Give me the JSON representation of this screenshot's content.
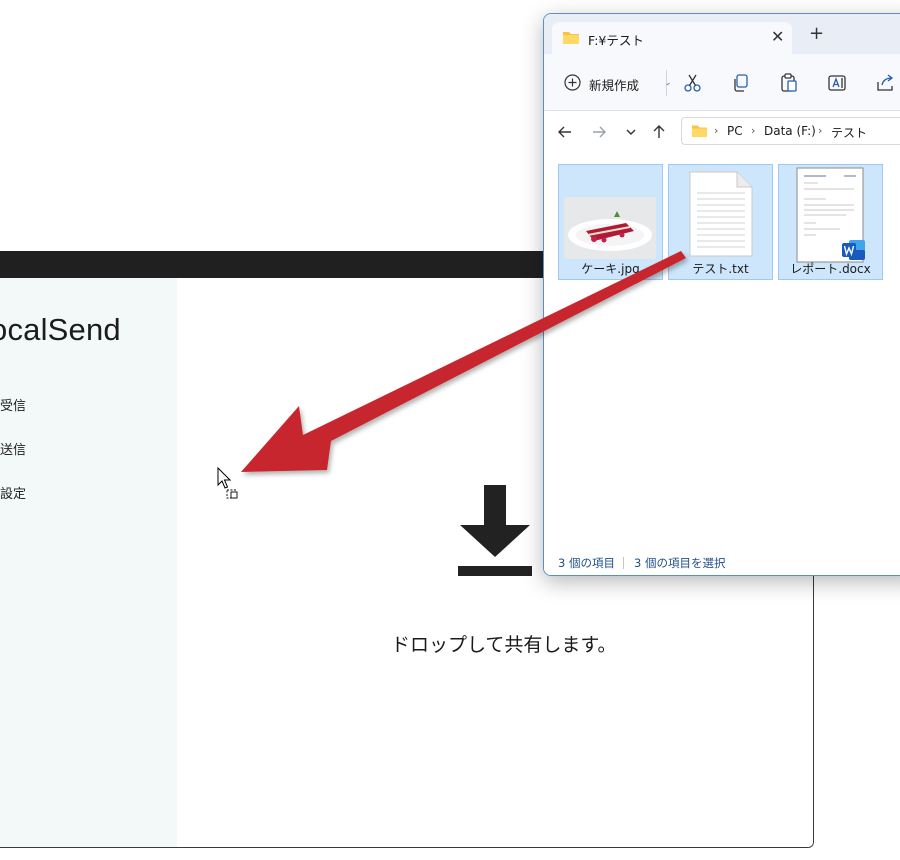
{
  "localsend": {
    "app_name": "ocalSend",
    "nav": [
      {
        "label": "受信"
      },
      {
        "label": "送信"
      },
      {
        "label": "設定"
      }
    ],
    "drop_text": "ドロップして共有します。"
  },
  "explorer": {
    "tab_title": "F:¥テスト",
    "tab_close": "✕",
    "new_tab": "+",
    "toolbar": {
      "new_label": "新規作成",
      "new_chevron": "⌄"
    },
    "icons": {
      "new": "plus-circle-icon",
      "cut": "scissors-icon",
      "copy": "copy-icon",
      "paste": "clipboard-icon",
      "rename": "rename-icon",
      "share": "share-icon",
      "back": "arrow-left-icon",
      "forward": "arrow-right-icon",
      "recent": "chevron-down-icon",
      "up": "arrow-up-icon",
      "folder": "folder-icon",
      "word": "word-icon"
    },
    "breadcrumb": [
      "PC",
      "Data (F:)",
      "テスト"
    ],
    "breadcrumb_sep": "›",
    "files": [
      {
        "name": "ケーキ.jpg"
      },
      {
        "name": "テスト.txt"
      },
      {
        "name": "レポート.docx"
      }
    ],
    "status": {
      "count": "3 個の項目",
      "selected": "3 個の項目を選択"
    }
  },
  "colors": {
    "arrow": "#c8282d",
    "selection": "#cde6fb",
    "localsend_sidebar": "#f3f8f8",
    "titlebar": "#202020",
    "status_text": "#1f4e8c"
  }
}
